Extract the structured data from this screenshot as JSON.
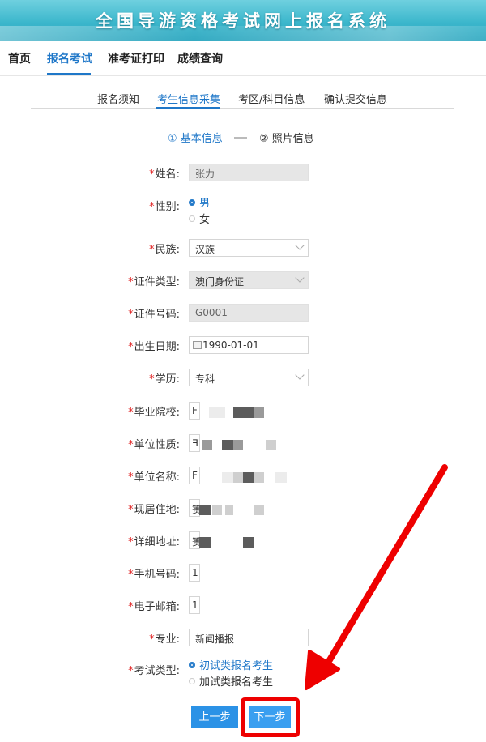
{
  "banner": {
    "title": "全国导游资格考试网上报名系统"
  },
  "topnav": {
    "items": [
      {
        "label": "首页"
      },
      {
        "label": "报名考试"
      },
      {
        "label": "准考证打印"
      },
      {
        "label": "成绩查询"
      }
    ]
  },
  "steps_tabs": {
    "items": [
      {
        "label": "报名须知"
      },
      {
        "label": "考生信息采集"
      },
      {
        "label": "考区/科目信息"
      },
      {
        "label": "确认提交信息"
      }
    ]
  },
  "substeps": {
    "step1": "① 基本信息",
    "step2": "② 照片信息"
  },
  "form": {
    "name": {
      "label": "姓名:",
      "value": "张力"
    },
    "gender": {
      "label": "性别:",
      "options": [
        "男",
        "女"
      ],
      "selected": "男"
    },
    "ethnicity": {
      "label": "民族:",
      "value": "汉族"
    },
    "id_type": {
      "label": "证件类型:",
      "value": "澳门身份证"
    },
    "id_number": {
      "label": "证件号码:",
      "value": "G0001"
    },
    "birth_date": {
      "label": "出生日期:",
      "value": "1990-01-01"
    },
    "education": {
      "label": "学历:",
      "value": "专科"
    },
    "school": {
      "label": "毕业院校:",
      "value": "F"
    },
    "employer_type": {
      "label": "单位性质:",
      "value": "∃"
    },
    "employer_name": {
      "label": "单位名称:",
      "value": "F"
    },
    "residence": {
      "label": "现居住地:",
      "value": "箦"
    },
    "address": {
      "label": "详细地址:",
      "value": "箦"
    },
    "phone": {
      "label": "手机号码:",
      "value": "1"
    },
    "email": {
      "label": "电子邮箱:",
      "value": "1"
    },
    "major": {
      "label": "专业:",
      "value": "新闻播报"
    },
    "exam_type": {
      "label": "考试类型:",
      "options": [
        "初试类报名考生",
        "加试类报名考生"
      ],
      "selected": "初试类报名考生"
    },
    "required_mark": "*"
  },
  "buttons": {
    "prev": "上一步",
    "next": "下一步"
  },
  "colors": {
    "accent": "#1f77c8",
    "button": "#2b92e6",
    "annotation": "#ee0000"
  }
}
